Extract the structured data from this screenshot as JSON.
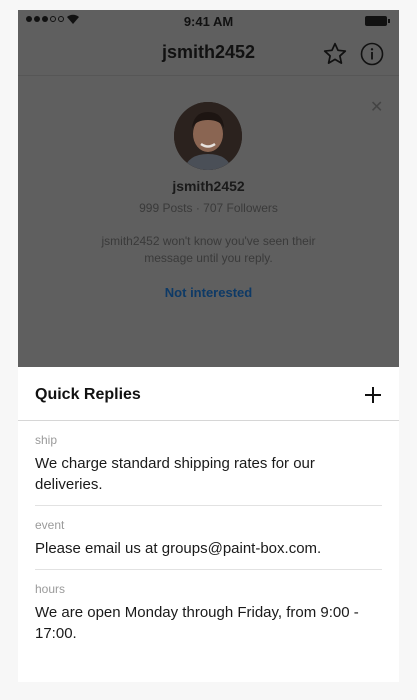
{
  "status_bar": {
    "time": "9:41 AM"
  },
  "nav": {
    "title": "jsmith2452",
    "star_icon": "star-icon",
    "info_icon": "info-icon"
  },
  "profile": {
    "name": "jsmith2452",
    "stats": "999 Posts · 707 Followers",
    "message": "jsmith2452 won't know you've seen their message until you reply.",
    "not_interested": "Not interested"
  },
  "quick_replies": {
    "title": "Quick Replies",
    "items": [
      {
        "shortcut": "ship",
        "text": "We charge standard shipping rates for our deliveries."
      },
      {
        "shortcut": "event",
        "text": "Please email us at groups@paint-box.com."
      },
      {
        "shortcut": "hours",
        "text": "We are open Monday through Friday, from 9:00 - 17:00."
      }
    ]
  },
  "colors": {
    "dim_overlay": "#5f5f5f",
    "link": "#0e3a66",
    "sheet_bg": "#ffffff"
  }
}
